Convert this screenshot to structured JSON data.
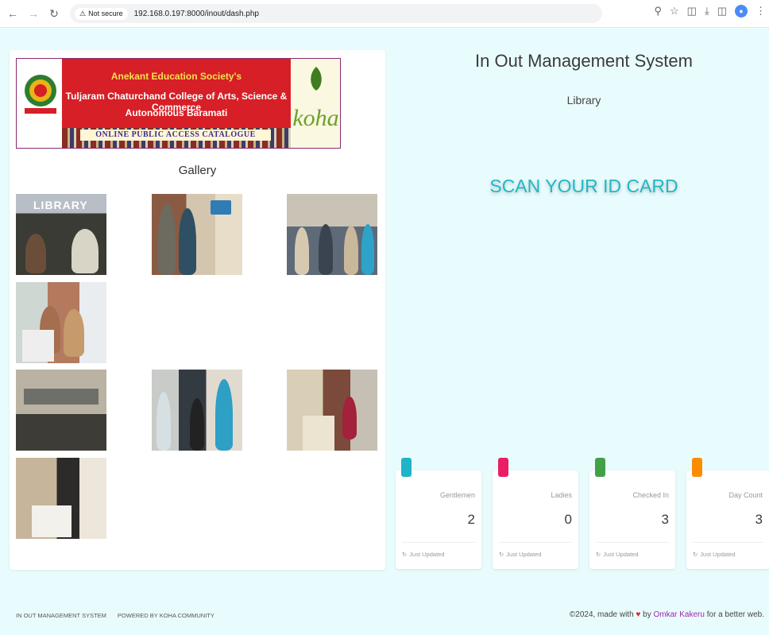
{
  "browser": {
    "security_label": "Not secure",
    "url": "192.168.0.197:8000/inout/dash.php"
  },
  "banner": {
    "line1": "Anekant Education Society's",
    "line2": "Tuljaram Chaturchand College of Arts, Science & Commerce",
    "line3": "Autonomous  Baramati",
    "opac": "ONLINE PUBLIC ACCESS CATALOGUE",
    "koha": "koha"
  },
  "gallery": {
    "title": "Gallery",
    "photo1_text": "LIBRARY"
  },
  "header": {
    "title": "In Out Management System",
    "subtitle": "Library",
    "scan_prompt": "SCAN YOUR ID CARD"
  },
  "stats": [
    {
      "label": "Gentlemen",
      "value": "2",
      "updated": "Just Updated",
      "color": "#1fb4c6"
    },
    {
      "label": "Ladies",
      "value": "0",
      "updated": "Just Updated",
      "color": "#e91e63"
    },
    {
      "label": "Checked In",
      "value": "3",
      "updated": "Just Updated",
      "color": "#43a047"
    },
    {
      "label": "Day Count",
      "value": "3",
      "updated": "Just Updated",
      "color": "#fb8c00"
    }
  ],
  "footer": {
    "link1": "IN OUT MANAGEMENT SYSTEM",
    "link2": "POWERED BY KOHA COMMUNITY",
    "made_prefix": "©2024, made with",
    "by": "by",
    "author": "Omkar Kakeru",
    "suffix": "for a better web."
  }
}
